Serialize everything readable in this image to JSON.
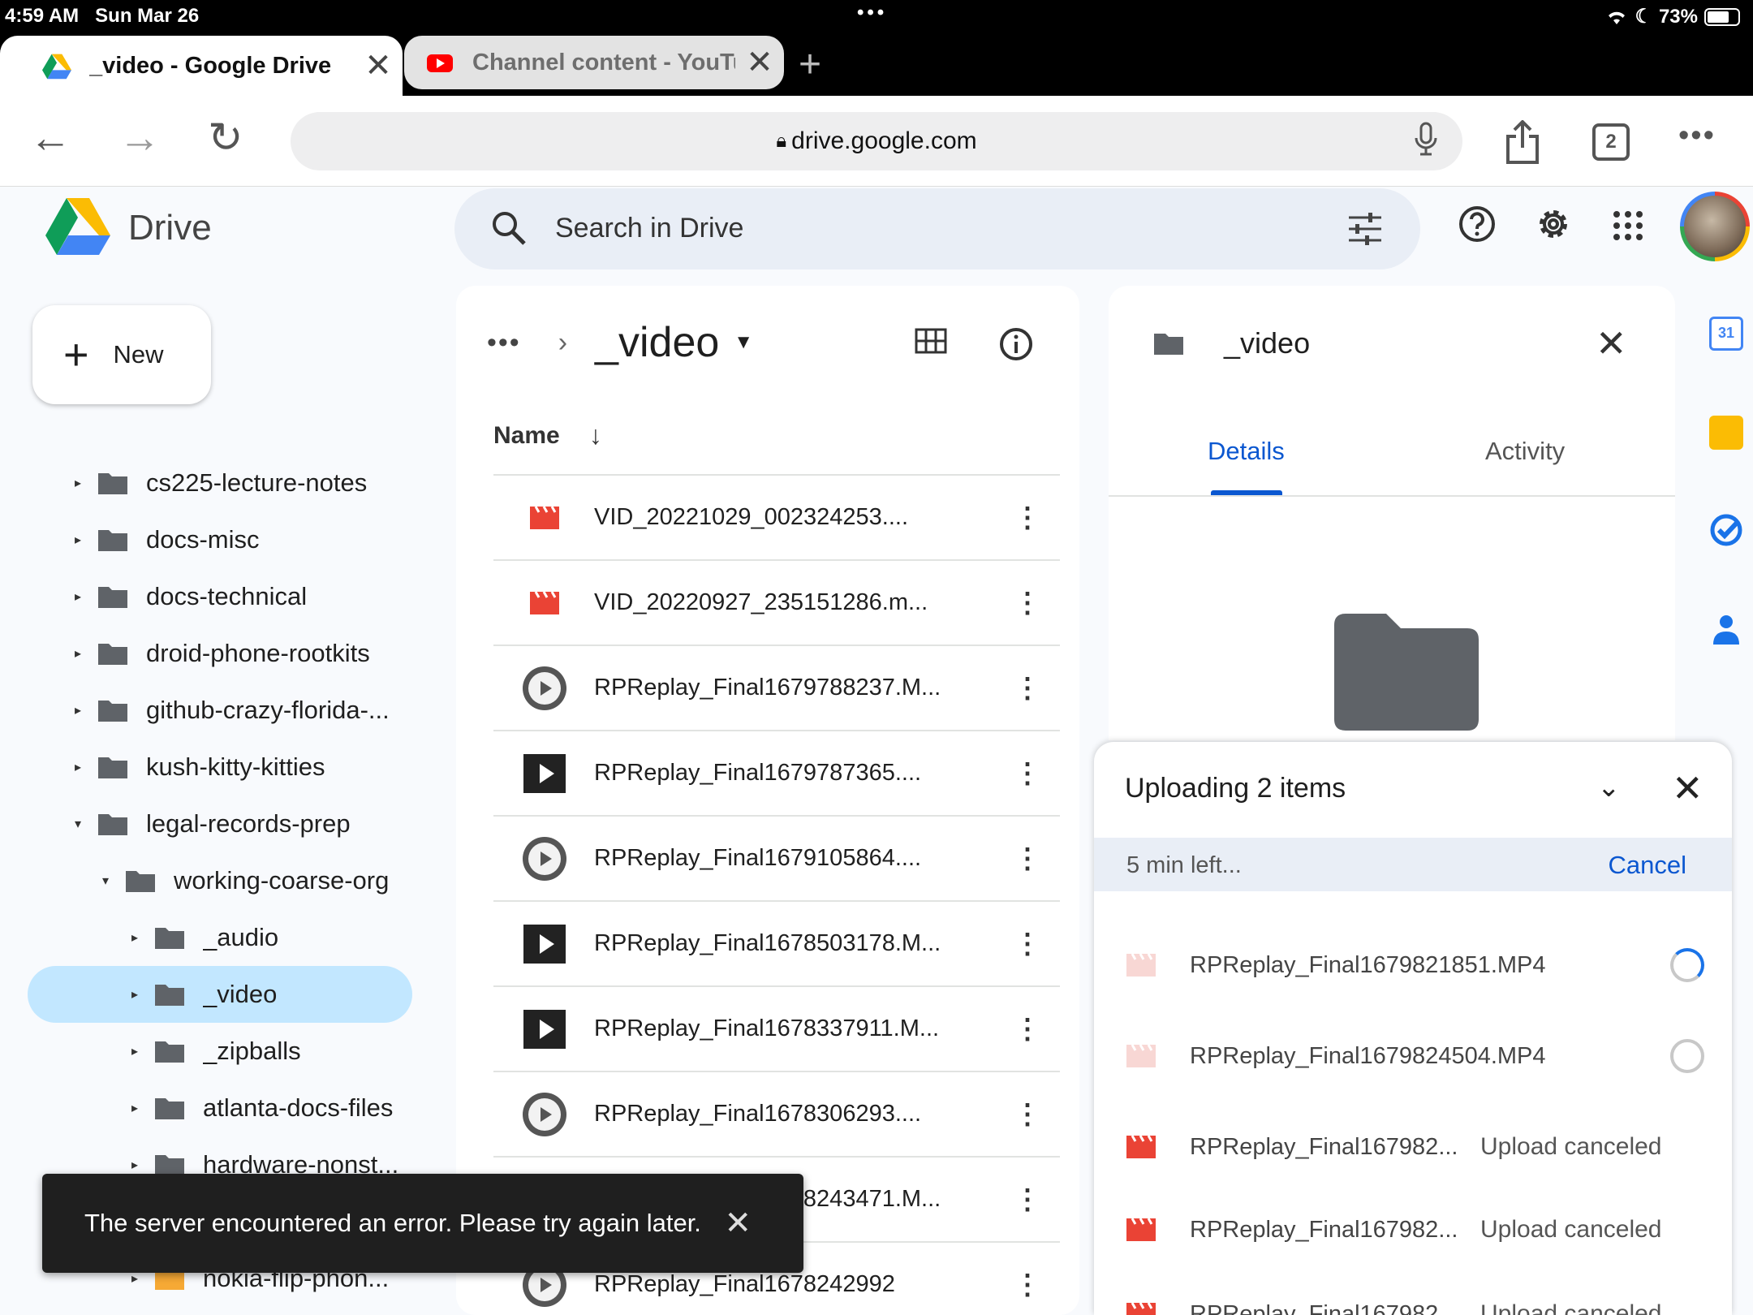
{
  "status_bar": {
    "time": "4:59 AM",
    "date": "Sun Mar 26",
    "battery": "73%",
    "battery_level": 0.73
  },
  "tabs": [
    {
      "title": "_video - Google Drive",
      "active": true
    },
    {
      "title": "Channel content - YouTube",
      "active": false
    }
  ],
  "url": "drive.google.com",
  "tab_count": "2",
  "header": {
    "app_name": "Drive",
    "search_placeholder": "Search in Drive"
  },
  "new_button": "New",
  "sidebar": {
    "items": [
      {
        "label": "cs225-lecture-notes"
      },
      {
        "label": "docs-misc"
      },
      {
        "label": "docs-technical"
      },
      {
        "label": "droid-phone-rootkits"
      },
      {
        "label": "github-crazy-florida-..."
      },
      {
        "label": "kush-kitty-kitties"
      },
      {
        "label": "legal-records-prep"
      },
      {
        "label": "working-coarse-org"
      },
      {
        "label": "_audio"
      },
      {
        "label": "_video"
      },
      {
        "label": "_zipballs"
      },
      {
        "label": "atlanta-docs-files"
      },
      {
        "label": "hardware-nonst..."
      },
      {
        "label": ""
      },
      {
        "label": "nokia-flip-phon..."
      }
    ]
  },
  "file_list": {
    "breadcrumb_current": "_video",
    "column_name": "Name",
    "files": [
      {
        "name": "VID_20221029_002324253...."
      },
      {
        "name": "VID_20220927_235151286.m..."
      },
      {
        "name": "RPReplay_Final1679788237.M..."
      },
      {
        "name": "RPReplay_Final1679787365...."
      },
      {
        "name": "RPReplay_Final1679105864...."
      },
      {
        "name": "RPReplay_Final1678503178.M..."
      },
      {
        "name": "RPReplay_Final1678337911.M..."
      },
      {
        "name": "RPReplay_Final1678306293...."
      },
      {
        "name": "RPReplay_Final1678243471.M..."
      },
      {
        "name": "RPReplay_Final1678242992"
      }
    ]
  },
  "details": {
    "title": "_video",
    "tabs": [
      "Details",
      "Activity"
    ],
    "calendar_day": "31"
  },
  "upload": {
    "title": "Uploading 2 items",
    "time_left": "5 min left...",
    "cancel": "Cancel",
    "items": [
      {
        "name": "RPReplay_Final1679821851.MP4",
        "status": ""
      },
      {
        "name": "RPReplay_Final1679824504.MP4",
        "status": ""
      },
      {
        "name": "RPReplay_Final167982...",
        "status": "Upload canceled"
      },
      {
        "name": "RPReplay_Final167982...",
        "status": "Upload canceled"
      },
      {
        "name": "RPReplay_Final167982...",
        "status": "Upload canceled"
      }
    ]
  },
  "snackbar": {
    "message": "The server encountered an error. Please try again later."
  }
}
